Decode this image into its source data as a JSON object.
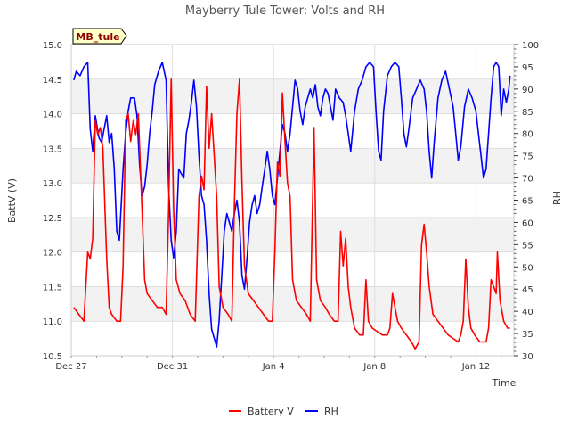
{
  "chart_data": {
    "type": "line",
    "title": "Mayberry Tule Tower: Volts and RH",
    "xlabel": "Time",
    "ylabel_left": "BattV (V)",
    "ylabel_right": "RH",
    "station_tag": "MB_tule",
    "x_tick_labels": [
      "Dec 27",
      "Dec 31",
      "Jan 4",
      "Jan 8",
      "Jan 12"
    ],
    "x_tick_days": [
      0,
      4,
      8,
      12,
      16
    ],
    "x_range_days": [
      0,
      17.5
    ],
    "y_left_range": [
      10.5,
      15.0
    ],
    "y_left_ticks": [
      "10.5",
      "11.0",
      "11.5",
      "12.0",
      "12.5",
      "13.0",
      "13.5",
      "14.0",
      "14.5",
      "15.0"
    ],
    "y_right_range": [
      30,
      100
    ],
    "y_right_ticks": [
      "30",
      "35",
      "40",
      "45",
      "50",
      "55",
      "60",
      "65",
      "70",
      "75",
      "80",
      "85",
      "90",
      "95",
      "100"
    ],
    "grid": true,
    "legend_position": "bottom-center",
    "series": [
      {
        "name": "Battery V",
        "axis": "left",
        "color": "#ff0000",
        "points": [
          [
            0.1,
            11.2
          ],
          [
            0.3,
            11.1
          ],
          [
            0.5,
            11.0
          ],
          [
            0.65,
            12.0
          ],
          [
            0.75,
            11.9
          ],
          [
            0.85,
            12.2
          ],
          [
            0.95,
            13.9
          ],
          [
            1.05,
            13.7
          ],
          [
            1.15,
            13.8
          ],
          [
            1.25,
            13.5
          ],
          [
            1.4,
            11.9
          ],
          [
            1.5,
            11.2
          ],
          [
            1.6,
            11.1
          ],
          [
            1.8,
            11.0
          ],
          [
            1.95,
            11.0
          ],
          [
            2.05,
            11.8
          ],
          [
            2.15,
            13.9
          ],
          [
            2.25,
            14.0
          ],
          [
            2.35,
            13.6
          ],
          [
            2.45,
            13.9
          ],
          [
            2.55,
            13.7
          ],
          [
            2.65,
            14.0
          ],
          [
            2.8,
            12.6
          ],
          [
            2.9,
            11.6
          ],
          [
            3.0,
            11.4
          ],
          [
            3.2,
            11.3
          ],
          [
            3.4,
            11.2
          ],
          [
            3.6,
            11.2
          ],
          [
            3.75,
            11.1
          ],
          [
            3.85,
            12.6
          ],
          [
            3.95,
            14.5
          ],
          [
            4.05,
            12.6
          ],
          [
            4.15,
            11.6
          ],
          [
            4.3,
            11.4
          ],
          [
            4.5,
            11.3
          ],
          [
            4.7,
            11.1
          ],
          [
            4.9,
            11.0
          ],
          [
            5.05,
            12.8
          ],
          [
            5.15,
            13.1
          ],
          [
            5.25,
            12.9
          ],
          [
            5.35,
            14.4
          ],
          [
            5.45,
            13.5
          ],
          [
            5.55,
            14.0
          ],
          [
            5.65,
            13.4
          ],
          [
            5.75,
            12.8
          ],
          [
            5.85,
            11.5
          ],
          [
            6.0,
            11.2
          ],
          [
            6.2,
            11.1
          ],
          [
            6.35,
            11.0
          ],
          [
            6.45,
            12.7
          ],
          [
            6.55,
            14.0
          ],
          [
            6.65,
            14.5
          ],
          [
            6.75,
            13.0
          ],
          [
            6.85,
            11.8
          ],
          [
            7.0,
            11.4
          ],
          [
            7.2,
            11.3
          ],
          [
            7.4,
            11.2
          ],
          [
            7.6,
            11.1
          ],
          [
            7.8,
            11.0
          ],
          [
            7.95,
            11.0
          ],
          [
            8.05,
            12.0
          ],
          [
            8.15,
            13.3
          ],
          [
            8.25,
            13.1
          ],
          [
            8.35,
            14.3
          ],
          [
            8.45,
            13.6
          ],
          [
            8.55,
            13.0
          ],
          [
            8.65,
            12.8
          ],
          [
            8.75,
            11.6
          ],
          [
            8.9,
            11.3
          ],
          [
            9.1,
            11.2
          ],
          [
            9.3,
            11.1
          ],
          [
            9.45,
            11.0
          ],
          [
            9.6,
            13.8
          ],
          [
            9.7,
            11.6
          ],
          [
            9.85,
            11.3
          ],
          [
            10.05,
            11.2
          ],
          [
            10.2,
            11.1
          ],
          [
            10.4,
            11.0
          ],
          [
            10.55,
            11.0
          ],
          [
            10.65,
            12.3
          ],
          [
            10.75,
            11.8
          ],
          [
            10.85,
            12.2
          ],
          [
            10.95,
            11.5
          ],
          [
            11.05,
            11.2
          ],
          [
            11.2,
            10.9
          ],
          [
            11.4,
            10.8
          ],
          [
            11.55,
            10.8
          ],
          [
            11.65,
            11.6
          ],
          [
            11.75,
            11.0
          ],
          [
            11.9,
            10.9
          ],
          [
            12.1,
            10.85
          ],
          [
            12.3,
            10.8
          ],
          [
            12.5,
            10.8
          ],
          [
            12.6,
            10.9
          ],
          [
            12.7,
            11.4
          ],
          [
            12.8,
            11.2
          ],
          [
            12.9,
            11.0
          ],
          [
            13.05,
            10.9
          ],
          [
            13.25,
            10.8
          ],
          [
            13.45,
            10.7
          ],
          [
            13.6,
            10.6
          ],
          [
            13.75,
            10.7
          ],
          [
            13.85,
            12.1
          ],
          [
            13.95,
            12.4
          ],
          [
            14.05,
            12.0
          ],
          [
            14.15,
            11.5
          ],
          [
            14.3,
            11.1
          ],
          [
            14.5,
            11.0
          ],
          [
            14.7,
            10.9
          ],
          [
            14.9,
            10.8
          ],
          [
            15.1,
            10.75
          ],
          [
            15.3,
            10.7
          ],
          [
            15.4,
            10.8
          ],
          [
            15.5,
            11.0
          ],
          [
            15.6,
            11.9
          ],
          [
            15.7,
            11.2
          ],
          [
            15.8,
            10.9
          ],
          [
            15.95,
            10.8
          ],
          [
            16.15,
            10.7
          ],
          [
            16.3,
            10.7
          ],
          [
            16.4,
            10.7
          ],
          [
            16.5,
            10.9
          ],
          [
            16.6,
            11.6
          ],
          [
            16.7,
            11.5
          ],
          [
            16.8,
            11.4
          ],
          [
            16.85,
            12.0
          ],
          [
            16.95,
            11.3
          ],
          [
            17.1,
            11.0
          ],
          [
            17.25,
            10.9
          ],
          [
            17.35,
            10.9
          ]
        ]
      },
      {
        "name": "RH",
        "axis": "right",
        "color": "#0000ff",
        "points": [
          [
            0.1,
            92
          ],
          [
            0.2,
            94
          ],
          [
            0.35,
            93
          ],
          [
            0.5,
            95
          ],
          [
            0.65,
            96
          ],
          [
            0.75,
            81
          ],
          [
            0.85,
            76
          ],
          [
            0.95,
            84
          ],
          [
            1.1,
            79
          ],
          [
            1.2,
            78
          ],
          [
            1.3,
            81
          ],
          [
            1.4,
            84
          ],
          [
            1.5,
            78
          ],
          [
            1.6,
            80
          ],
          [
            1.7,
            72
          ],
          [
            1.8,
            58
          ],
          [
            1.9,
            56
          ],
          [
            2.05,
            72
          ],
          [
            2.15,
            80
          ],
          [
            2.25,
            85
          ],
          [
            2.35,
            88
          ],
          [
            2.5,
            88
          ],
          [
            2.6,
            84
          ],
          [
            2.7,
            73
          ],
          [
            2.8,
            66
          ],
          [
            2.9,
            68
          ],
          [
            3.0,
            73
          ],
          [
            3.1,
            80
          ],
          [
            3.2,
            85
          ],
          [
            3.3,
            91
          ],
          [
            3.45,
            94
          ],
          [
            3.6,
            96
          ],
          [
            3.75,
            92
          ],
          [
            3.85,
            68
          ],
          [
            3.95,
            56
          ],
          [
            4.05,
            52
          ],
          [
            4.15,
            58
          ],
          [
            4.25,
            72
          ],
          [
            4.35,
            71
          ],
          [
            4.45,
            70
          ],
          [
            4.55,
            80
          ],
          [
            4.65,
            83
          ],
          [
            4.75,
            87
          ],
          [
            4.85,
            92
          ],
          [
            4.95,
            86
          ],
          [
            5.05,
            75
          ],
          [
            5.15,
            66
          ],
          [
            5.25,
            64
          ],
          [
            5.35,
            56
          ],
          [
            5.45,
            44
          ],
          [
            5.55,
            36
          ],
          [
            5.65,
            34
          ],
          [
            5.75,
            32
          ],
          [
            5.85,
            38
          ],
          [
            5.95,
            48
          ],
          [
            6.05,
            58
          ],
          [
            6.15,
            62
          ],
          [
            6.25,
            60
          ],
          [
            6.35,
            58
          ],
          [
            6.45,
            62
          ],
          [
            6.55,
            65
          ],
          [
            6.65,
            60
          ],
          [
            6.75,
            48
          ],
          [
            6.85,
            45
          ],
          [
            6.95,
            52
          ],
          [
            7.05,
            60
          ],
          [
            7.15,
            64
          ],
          [
            7.25,
            66
          ],
          [
            7.35,
            62
          ],
          [
            7.45,
            64
          ],
          [
            7.55,
            68
          ],
          [
            7.65,
            72
          ],
          [
            7.75,
            76
          ],
          [
            7.85,
            72
          ],
          [
            7.95,
            66
          ],
          [
            8.05,
            64
          ],
          [
            8.15,
            70
          ],
          [
            8.25,
            76
          ],
          [
            8.35,
            82
          ],
          [
            8.45,
            80
          ],
          [
            8.55,
            76
          ],
          [
            8.65,
            80
          ],
          [
            8.75,
            86
          ],
          [
            8.85,
            92
          ],
          [
            8.95,
            90
          ],
          [
            9.05,
            85
          ],
          [
            9.15,
            82
          ],
          [
            9.25,
            86
          ],
          [
            9.35,
            88
          ],
          [
            9.45,
            90
          ],
          [
            9.55,
            88
          ],
          [
            9.65,
            91
          ],
          [
            9.75,
            86
          ],
          [
            9.85,
            84
          ],
          [
            9.95,
            88
          ],
          [
            10.05,
            90
          ],
          [
            10.15,
            89
          ],
          [
            10.25,
            86
          ],
          [
            10.35,
            83
          ],
          [
            10.45,
            90
          ],
          [
            10.6,
            88
          ],
          [
            10.75,
            87
          ],
          [
            10.85,
            84
          ],
          [
            10.95,
            80
          ],
          [
            11.05,
            76
          ],
          [
            11.2,
            85
          ],
          [
            11.35,
            90
          ],
          [
            11.5,
            92
          ],
          [
            11.65,
            95
          ],
          [
            11.8,
            96
          ],
          [
            11.95,
            95
          ],
          [
            12.05,
            85
          ],
          [
            12.15,
            76
          ],
          [
            12.25,
            74
          ],
          [
            12.35,
            85
          ],
          [
            12.5,
            93
          ],
          [
            12.65,
            95
          ],
          [
            12.8,
            96
          ],
          [
            12.95,
            95
          ],
          [
            13.05,
            88
          ],
          [
            13.15,
            80
          ],
          [
            13.25,
            77
          ],
          [
            13.35,
            81
          ],
          [
            13.5,
            88
          ],
          [
            13.65,
            90
          ],
          [
            13.8,
            92
          ],
          [
            13.95,
            90
          ],
          [
            14.05,
            85
          ],
          [
            14.15,
            76
          ],
          [
            14.25,
            70
          ],
          [
            14.35,
            78
          ],
          [
            14.5,
            88
          ],
          [
            14.65,
            92
          ],
          [
            14.8,
            94
          ],
          [
            14.95,
            90
          ],
          [
            15.1,
            86
          ],
          [
            15.2,
            80
          ],
          [
            15.3,
            74
          ],
          [
            15.4,
            77
          ],
          [
            15.55,
            86
          ],
          [
            15.7,
            90
          ],
          [
            15.85,
            88
          ],
          [
            16.0,
            85
          ],
          [
            16.1,
            80
          ],
          [
            16.2,
            75
          ],
          [
            16.3,
            70
          ],
          [
            16.4,
            72
          ],
          [
            16.5,
            80
          ],
          [
            16.6,
            88
          ],
          [
            16.7,
            95
          ],
          [
            16.8,
            96
          ],
          [
            16.9,
            95
          ],
          [
            17.0,
            84
          ],
          [
            17.1,
            90
          ],
          [
            17.2,
            87
          ],
          [
            17.3,
            90
          ],
          [
            17.35,
            93
          ]
        ]
      }
    ]
  }
}
